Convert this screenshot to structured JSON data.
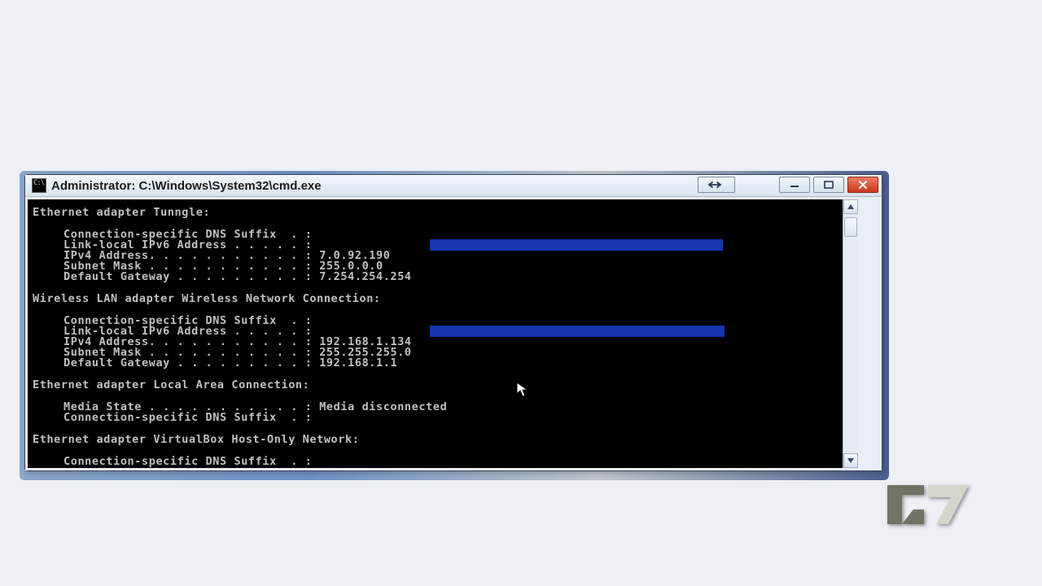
{
  "window": {
    "title": "Administrator: C:\\Windows\\System32\\cmd.exe"
  },
  "adapters": [
    {
      "header": "Ethernet adapter Tunngle:",
      "rows": [
        {
          "label": "Connection-specific DNS Suffix  . :",
          "value": ""
        },
        {
          "label": "Link-local IPv6 Address . . . . . :",
          "value": "",
          "redacted": true
        },
        {
          "label": "IPv4 Address. . . . . . . . . . . :",
          "value": "7.0.92.190"
        },
        {
          "label": "Subnet Mask . . . . . . . . . . . :",
          "value": "255.0.0.0"
        },
        {
          "label": "Default Gateway . . . . . . . . . :",
          "value": "7.254.254.254"
        }
      ]
    },
    {
      "header": "Wireless LAN adapter Wireless Network Connection:",
      "rows": [
        {
          "label": "Connection-specific DNS Suffix  . :",
          "value": ""
        },
        {
          "label": "Link-local IPv6 Address . . . . . :",
          "value": "",
          "redacted": true
        },
        {
          "label": "IPv4 Address. . . . . . . . . . . :",
          "value": "192.168.1.134"
        },
        {
          "label": "Subnet Mask . . . . . . . . . . . :",
          "value": "255.255.255.0"
        },
        {
          "label": "Default Gateway . . . . . . . . . :",
          "value": "192.168.1.1"
        }
      ]
    },
    {
      "header": "Ethernet adapter Local Area Connection:",
      "rows": [
        {
          "label": "Media State . . . . . . . . . . . :",
          "value": "Media disconnected"
        },
        {
          "label": "Connection-specific DNS Suffix  . :",
          "value": ""
        }
      ]
    },
    {
      "header": "Ethernet adapter VirtualBox Host-Only Network:",
      "rows": [
        {
          "label": "Connection-specific DNS Suffix  . :",
          "value": ""
        }
      ]
    }
  ]
}
